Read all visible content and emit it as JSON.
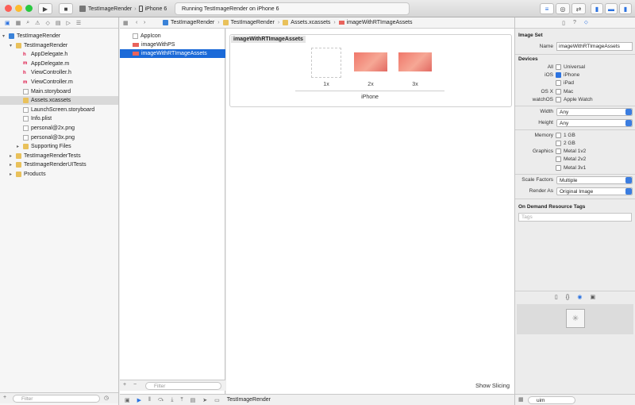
{
  "toolbar": {
    "scheme": "TestImageRender",
    "device": "iPhone 6",
    "activity": "Running TestImageRender on iPhone 6"
  },
  "navigator": {
    "items": [
      {
        "label": "TestImageRender",
        "type": "project",
        "indent": 0,
        "open": true
      },
      {
        "label": "TestImageRender",
        "type": "folder",
        "indent": 1,
        "open": true
      },
      {
        "label": "AppDelegate.h",
        "type": "h",
        "indent": 2
      },
      {
        "label": "AppDelegate.m",
        "type": "m",
        "indent": 2
      },
      {
        "label": "ViewController.h",
        "type": "h",
        "indent": 2
      },
      {
        "label": "ViewController.m",
        "type": "m",
        "indent": 2
      },
      {
        "label": "Main.storyboard",
        "type": "file",
        "indent": 2
      },
      {
        "label": "Assets.xcassets",
        "type": "folder",
        "indent": 2,
        "selected": true
      },
      {
        "label": "LaunchScreen.storyboard",
        "type": "file",
        "indent": 2
      },
      {
        "label": "Info.plist",
        "type": "file",
        "indent": 2
      },
      {
        "label": "personal@2x.png",
        "type": "file",
        "indent": 2
      },
      {
        "label": "personal@3x.png",
        "type": "file",
        "indent": 2
      },
      {
        "label": "Supporting Files",
        "type": "folder",
        "indent": 2,
        "closed": true
      },
      {
        "label": "TestImageRenderTests",
        "type": "folder",
        "indent": 1,
        "closed": true
      },
      {
        "label": "TestImageRenderUITests",
        "type": "folder",
        "indent": 1,
        "closed": true
      },
      {
        "label": "Products",
        "type": "folder",
        "indent": 1,
        "closed": true
      }
    ],
    "filter_placeholder": "Filter"
  },
  "asset_list": {
    "items": [
      {
        "label": "AppIcon"
      },
      {
        "label": "imageWithPS"
      },
      {
        "label": "imageWithRTImageAssets",
        "selected": true
      }
    ],
    "filter_placeholder": "Filter",
    "add": "+",
    "remove": "−"
  },
  "jumpbar": {
    "crumbs": [
      "TestImageRender",
      "TestImageRender",
      "Assets.xcassets",
      "imageWithRTImageAssets"
    ]
  },
  "editor": {
    "set_title": "imageWithRTImageAssets",
    "slots": [
      "1x",
      "2x",
      "3x"
    ],
    "device_label": "iPhone",
    "show_slicing": "Show Slicing"
  },
  "inspector": {
    "image_set_header": "Image Set",
    "name_label": "Name",
    "name_value": "imageWithRTImageAssets",
    "devices_header": "Devices",
    "all_label": "All",
    "universal": "Universal",
    "ios_label": "iOS",
    "iphone": "iPhone",
    "ipad": "iPad",
    "osx_label": "OS X",
    "mac": "Mac",
    "watchos_label": "watchOS",
    "apple_watch": "Apple Watch",
    "width_label": "Width",
    "width_value": "Any",
    "height_label": "Height",
    "height_value": "Any",
    "memory_label": "Memory",
    "mem1": "1 GB",
    "mem2": "2 GB",
    "graphics_label": "Graphics",
    "metal1": "Metal 1v2",
    "metal2": "Metal 2v2",
    "metal3": "Metal 3v1",
    "scale_label": "Scale Factors",
    "scale_value": "Multiple",
    "render_label": "Render As",
    "render_value": "Original Image",
    "odr_header": "On Demand Resource Tags",
    "tags_placeholder": "Tags",
    "search_value": "uim"
  },
  "debug": {
    "target": "TestImageRender"
  },
  "colors": {
    "selection": "#1b6ad8",
    "accent": "#2b72e0",
    "image_fill": "#f0776a"
  }
}
